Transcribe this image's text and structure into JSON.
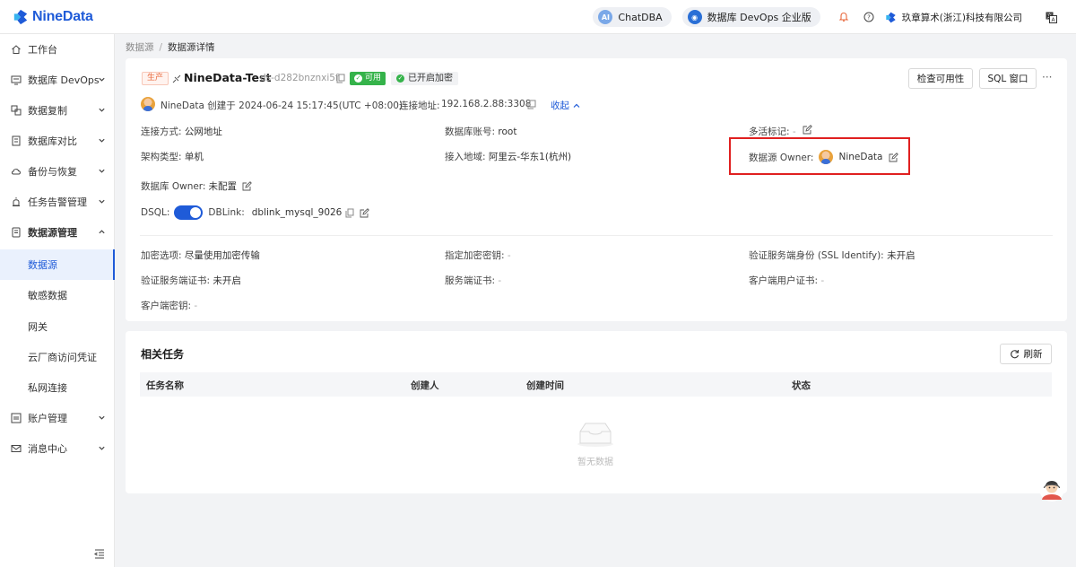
{
  "brand": {
    "name": "NineData"
  },
  "topbar": {
    "chatdba_label": "ChatDBA",
    "devops_label": "数据库 DevOps 企业版",
    "company_name": "玖章算术(浙江)科技有限公司"
  },
  "sidebar": {
    "items": [
      {
        "label": "工作台"
      },
      {
        "label": "数据库 DevOps"
      },
      {
        "label": "数据复制"
      },
      {
        "label": "数据库对比"
      },
      {
        "label": "备份与恢复"
      },
      {
        "label": "任务告警管理"
      },
      {
        "label": "数据源管理"
      },
      {
        "label": "账户管理"
      },
      {
        "label": "消息中心"
      }
    ],
    "sub_items": [
      {
        "label": "数据源"
      },
      {
        "label": "敏感数据"
      },
      {
        "label": "网关"
      },
      {
        "label": "云厂商访问凭证"
      },
      {
        "label": "私网连接"
      }
    ]
  },
  "breadcrumb": {
    "parent": "数据源",
    "separator": "/",
    "current": "数据源详情"
  },
  "datasource": {
    "env_tag": "生产",
    "name": "NineData-Test",
    "id": "ds-d282bnznxi5f",
    "status": "可用",
    "encryption": "已开启加密",
    "creator_line": "NineData 创建于 2024-06-24 15:17:45(UTC +08:00)",
    "address_label": "连接地址:",
    "address_value": "192.168.2.88:3308",
    "collapse_label": "收起",
    "check_button": "检查可用性",
    "sql_button": "SQL 窗口",
    "more": "···",
    "fields": {
      "conn_method_label": "连接方式:",
      "conn_method_value": "公网地址",
      "db_account_label": "数据库账号:",
      "db_account_value": "root",
      "multi_active_label": "多活标记:",
      "multi_active_value": "-",
      "arch_label": "架构类型:",
      "arch_value": "单机",
      "region_label": "接入地域:",
      "region_value": "阿里云-华东1(杭州)",
      "ds_owner_label": "数据源 Owner:",
      "ds_owner_value": "NineData",
      "db_owner_label": "数据库 Owner:",
      "db_owner_value": "未配置",
      "dsql_label": "DSQL:",
      "dsql_enabled": true,
      "dblink_label": "DBLink:",
      "dblink_value": "dblink_mysql_9026",
      "enc_option_label": "加密选项:",
      "enc_option_value": "尽量使用加密传输",
      "enc_key_label": "指定加密密钥:",
      "enc_key_value": "-",
      "ssl_verify_label": "验证服务端身份 (SSL Identify):",
      "ssl_verify_value": "未开启",
      "server_cert_verify_label": "验证服务端证书:",
      "server_cert_verify_value": "未开启",
      "server_cert_label": "服务端证书:",
      "server_cert_value": "-",
      "client_cert_label": "客户端用户证书:",
      "client_cert_value": "-",
      "client_key_label": "客户端密钥:",
      "client_key_value": "-"
    }
  },
  "tasks": {
    "title": "相关任务",
    "refresh_button": "刷新",
    "columns": [
      "任务名称",
      "创建人",
      "创建时间",
      "状态"
    ],
    "empty_text": "暂无数据"
  },
  "colors": {
    "accent": "#1f5bd8",
    "success": "#35b34a",
    "highlight": "#e02020",
    "env_tag": "#e8693d"
  }
}
